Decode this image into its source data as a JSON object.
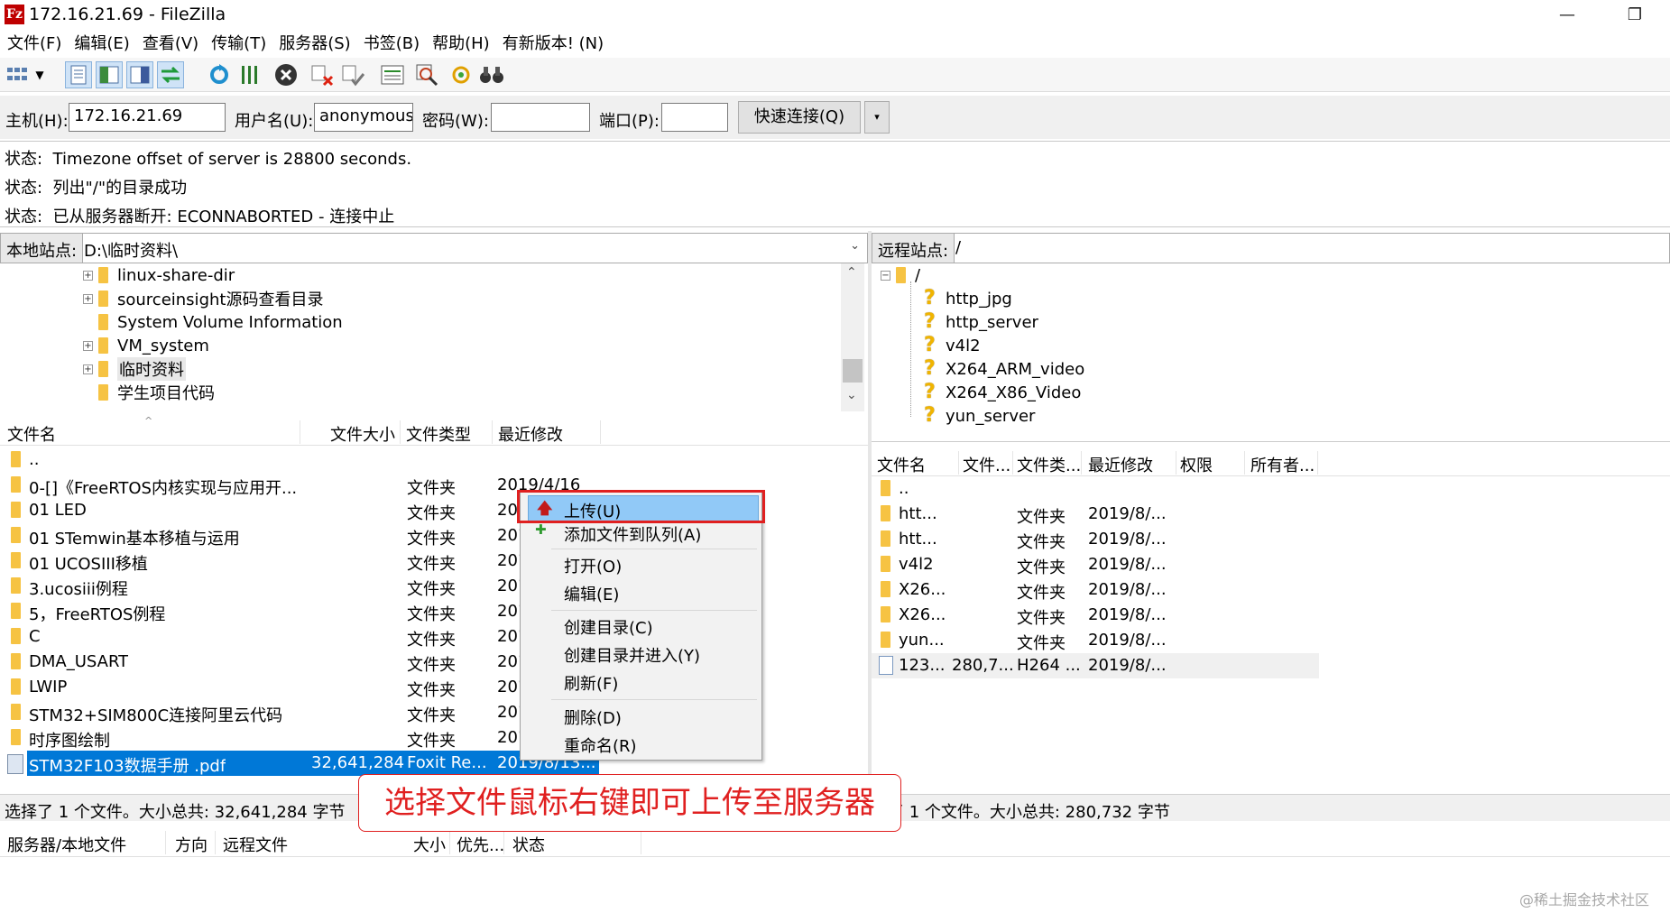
{
  "window": {
    "title": "172.16.21.69 - FileZilla",
    "app_icon": "Fz",
    "minimize": "—",
    "restore": "❐"
  },
  "menu": [
    "文件(F)",
    "编辑(E)",
    "查看(V)",
    "传输(T)",
    "服务器(S)",
    "书签(B)",
    "帮助(H)",
    "有新版本! (N)"
  ],
  "quickconnect": {
    "host_label": "主机(H):",
    "host_value": "172.16.21.69",
    "user_label": "用户名(U):",
    "user_value": "anonymous",
    "password_label": "密码(W):",
    "password_value": "",
    "port_label": "端口(P):",
    "port_value": "",
    "connect_label": "快速连接(Q)",
    "dropdown": "▾"
  },
  "log": [
    {
      "label": "状态:",
      "text": "Timezone offset of server is 28800 seconds."
    },
    {
      "label": "状态:",
      "text": "列出\"/\"的目录成功"
    },
    {
      "label": "状态:",
      "text": "已从服务器断开: ECONNABORTED - 连接中止"
    }
  ],
  "local": {
    "site_label": "本地站点:",
    "path": "D:\\临时资料\\",
    "tree": [
      {
        "name": "linux-share-dir",
        "expandable": true
      },
      {
        "name": "sourceinsight源码查看目录",
        "expandable": true
      },
      {
        "name": "System Volume Information",
        "expandable": false
      },
      {
        "name": "VM_system",
        "expandable": true
      },
      {
        "name": "临时资料",
        "expandable": true
      },
      {
        "name": "学生项目代码",
        "expandable": false
      }
    ],
    "columns": [
      "文件名",
      "文件大小",
      "文件类型",
      "最近修改"
    ],
    "files": [
      {
        "name": "..",
        "size": "",
        "type": "",
        "modified": ""
      },
      {
        "name": "0-[]《FreeRTOS内核实现与应用开...",
        "size": "",
        "type": "文件夹",
        "modified": "2019/4/16"
      },
      {
        "name": "01 LED",
        "size": "",
        "type": "文件夹",
        "modified": "201"
      },
      {
        "name": "01 STemwin基本移植与运用",
        "size": "",
        "type": "文件夹",
        "modified": "201"
      },
      {
        "name": "01 UCOSIII移植",
        "size": "",
        "type": "文件夹",
        "modified": "201"
      },
      {
        "name": "3.ucosiii例程",
        "size": "",
        "type": "文件夹",
        "modified": "201"
      },
      {
        "name": "5，FreeRTOS例程",
        "size": "",
        "type": "文件夹",
        "modified": "201"
      },
      {
        "name": "C",
        "size": "",
        "type": "文件夹",
        "modified": "201"
      },
      {
        "name": "DMA_USART",
        "size": "",
        "type": "文件夹",
        "modified": "201"
      },
      {
        "name": "LWIP",
        "size": "",
        "type": "文件夹",
        "modified": "201"
      },
      {
        "name": "STM32+SIM800C连接阿里云代码",
        "size": "",
        "type": "文件夹",
        "modified": "201"
      },
      {
        "name": "时序图绘制",
        "size": "",
        "type": "文件夹",
        "modified": "201"
      },
      {
        "name": "STM32F103数据手册 .pdf",
        "size": "32,641,284",
        "type": "Foxit Re...",
        "modified": "2019/8/13..."
      }
    ],
    "status": "选择了 1 个文件。大小总共: 32,641,284 字节"
  },
  "remote": {
    "site_label": "远程站点:",
    "path": "/",
    "tree_root": "/",
    "tree": [
      "http_jpg",
      "http_server",
      "v4l2",
      "X264_ARM_video",
      "X264_X86_Video",
      "yun_server"
    ],
    "columns": [
      "文件名",
      "文件...",
      "文件类...",
      "最近修改",
      "权限",
      "所有者..."
    ],
    "files": [
      {
        "name": "..",
        "size": "",
        "type": "",
        "modified": ""
      },
      {
        "name": "htt...",
        "size": "",
        "type": "文件夹",
        "modified": "2019/8/..."
      },
      {
        "name": "htt...",
        "size": "",
        "type": "文件夹",
        "modified": "2019/8/..."
      },
      {
        "name": "v4l2",
        "size": "",
        "type": "文件夹",
        "modified": "2019/8/..."
      },
      {
        "name": "X26...",
        "size": "",
        "type": "文件夹",
        "modified": "2019/8/..."
      },
      {
        "name": "X26...",
        "size": "",
        "type": "文件夹",
        "modified": "2019/8/..."
      },
      {
        "name": "yun...",
        "size": "",
        "type": "文件夹",
        "modified": "2019/8/..."
      },
      {
        "name": "123...",
        "size": "280,7...",
        "type": "H264 ...",
        "modified": "2019/8/..."
      }
    ],
    "status": "择了 1 个文件。大小总共: 280,732 字节"
  },
  "context_menu": {
    "items": [
      "上传(U)",
      "添加文件到队列(A)",
      "打开(O)",
      "编辑(E)",
      "创建目录(C)",
      "创建目录并进入(Y)",
      "刷新(F)",
      "删除(D)",
      "重命名(R)"
    ]
  },
  "annotation": "选择文件鼠标右键即可上传至服务器",
  "queue": {
    "columns": [
      "服务器/本地文件",
      "方向",
      "远程文件",
      "大小",
      "优先...",
      "状态"
    ]
  },
  "watermark": "@稀土掘金技术社区",
  "colors": {
    "selection": "#0078d7",
    "ctx_highlight": "#91c9f7",
    "annotation_red": "#e02020",
    "folder": "#f6c343"
  }
}
